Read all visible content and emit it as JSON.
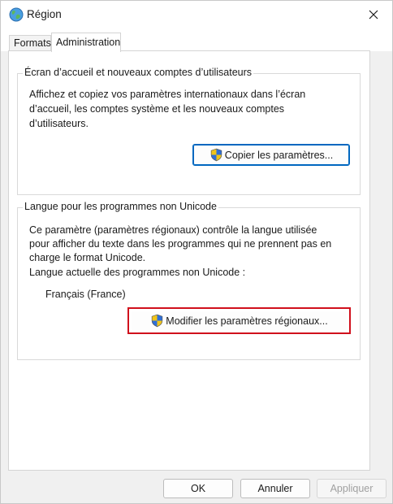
{
  "window": {
    "title": "Région",
    "title_icon": "globe-icon",
    "close_icon": "close-icon"
  },
  "tabs": [
    {
      "label": "Formats",
      "active": false
    },
    {
      "label": "Administration",
      "active": true
    }
  ],
  "welcome_group": {
    "legend": "Écran d’accueil et nouveaux comptes d’utilisateurs",
    "lines": [
      "Affichez et copiez vos paramètres internationaux dans l’écran",
      "d’accueil, les comptes système et les nouveaux comptes",
      "d’utilisateurs."
    ],
    "button_label": "Copier les paramètres...",
    "button_icon": "uac-shield-icon"
  },
  "unicode_group": {
    "legend": "Langue pour les programmes non Unicode",
    "lines": [
      "Ce paramètre (paramètres régionaux) contrôle la langue utilisée",
      "pour afficher du texte dans les programmes qui ne prennent pas en",
      "charge le format Unicode."
    ],
    "current_label": "Langue actuelle des programmes non Unicode :",
    "current_value": "Français (France)",
    "button_label": "Modifier les paramètres régionaux...",
    "button_icon": "uac-shield-icon",
    "highlight_color": "#d0101c"
  },
  "footer": {
    "ok_label": "OK",
    "cancel_label": "Annuler",
    "apply_label": "Appliquer"
  },
  "colors": {
    "accent": "#0067c0",
    "highlight": "#d0101c"
  }
}
